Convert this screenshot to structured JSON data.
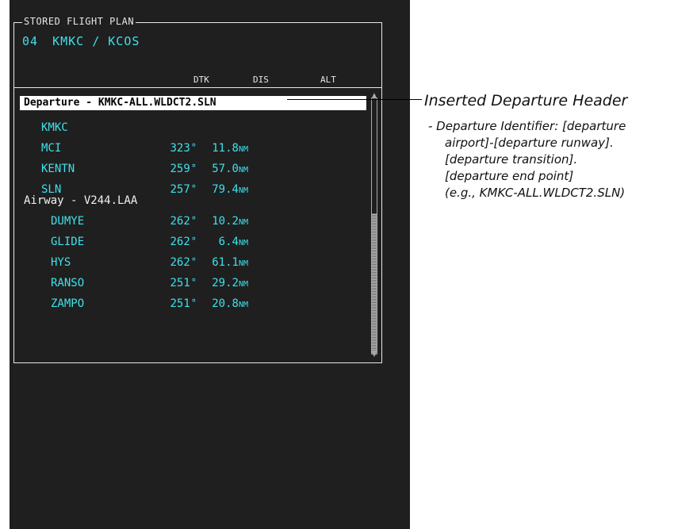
{
  "panel": {
    "title": "STORED FLIGHT PLAN",
    "plan_number": "04",
    "route": "KMKC / KCOS"
  },
  "columns": {
    "dtk": "DTK",
    "dis": "DIS",
    "alt": "ALT"
  },
  "departure_header": "Departure - KMKC-ALL.WLDCT2.SLN",
  "departure_legs": [
    {
      "id": "KMKC",
      "dtk": "",
      "dis": ""
    },
    {
      "id": "MCI",
      "dtk": "323",
      "dis": "11.8"
    },
    {
      "id": "KENTN",
      "dtk": "259",
      "dis": "57.0"
    },
    {
      "id": "SLN",
      "dtk": "257",
      "dis": "79.4"
    }
  ],
  "airway_header": "Airway - V244.LAA",
  "airway_legs": [
    {
      "id": "DUMYE",
      "dtk": "262",
      "dis": "10.2"
    },
    {
      "id": "GLIDE",
      "dtk": "262",
      "dis": "6.4"
    },
    {
      "id": "HYS",
      "dtk": "262",
      "dis": "61.1"
    },
    {
      "id": "RANSO",
      "dtk": "251",
      "dis": "29.2"
    },
    {
      "id": "ZAMPO",
      "dtk": "251",
      "dis": "20.8"
    }
  ],
  "units": {
    "degree": "°",
    "distance": "NM"
  },
  "callout": {
    "title": "Inserted Departure Header",
    "line1": "- Departure Identifier: [departure",
    "line2": "airport]-[departure runway].",
    "line3": "[departure transition].",
    "line4": "[departure end point]",
    "line5": "(e.g., KMKC-ALL.WLDCT2.SLN)"
  },
  "colors": {
    "screen_bg": "#1f1f1f",
    "cyan": "#3fe0ea",
    "white": "#f2f2f2",
    "highlight": "#ffffff"
  }
}
